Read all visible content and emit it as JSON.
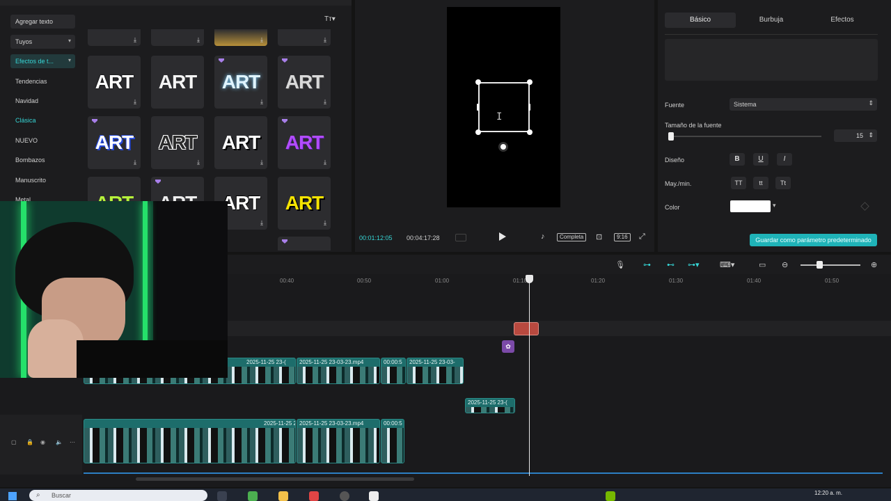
{
  "left_panel": {
    "add_text": "Agregar texto",
    "mine": "Tuyos",
    "effects": "Efectos de t...",
    "categories": [
      "Tendencias",
      "Navidad",
      "Clásica",
      "NUEVO",
      "Bombazos",
      "Manuscrito",
      "Metal"
    ],
    "tile_label": "ART"
  },
  "preview": {
    "time_current": "00:01:12:05",
    "time_total": "00:04:17:28",
    "complete_label": "Completa",
    "ratio_label": "9:16"
  },
  "right_panel": {
    "tabs": [
      "Básico",
      "Burbuja",
      "Efectos"
    ],
    "font_label": "Fuente",
    "font_value": "Sistema",
    "size_label": "Tamaño de la fuente",
    "size_value": "15",
    "design_label": "Diseño",
    "case_label": "May./min.",
    "case_opts": [
      "TT",
      "tt",
      "Tt"
    ],
    "color_label": "Color",
    "save_preset": "Guardar como parámetro predeterminado",
    "text_color": "#ffffff"
  },
  "timeline": {
    "ticks": [
      "00:40",
      "00:50",
      "01:00",
      "01:10",
      "01:20",
      "01:30",
      "01:40",
      "01:50"
    ],
    "clips_upper": [
      "2025-11-25 23-(",
      "2025-11-25 23-03-23.mp4",
      "00:00:5",
      "2025-11-25 23-03-"
    ],
    "clip_small": "2025-11-25 23-(",
    "clips_main": [
      "2025-11-25 23-(",
      "2025-11-25 23-03-23.mp4",
      "00:00:5"
    ]
  },
  "taskbar": {
    "search_placeholder": "Buscar",
    "clock": "12:20 a. m."
  },
  "colors": {
    "accent": "#36d6d6",
    "clip": "#1d6d6b",
    "text_clip": "#b8493f"
  }
}
